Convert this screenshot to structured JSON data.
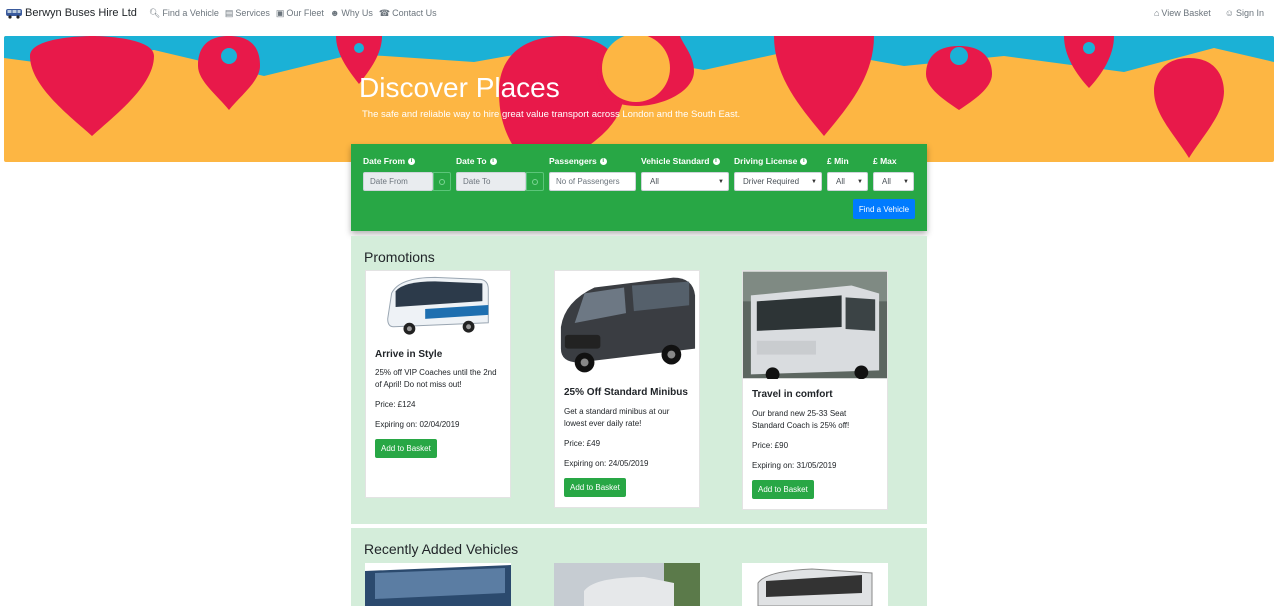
{
  "navbar": {
    "brand": "Berwyn Buses Hire Ltd",
    "items": [
      {
        "label": "Find a Vehicle",
        "icon": "search-icon"
      },
      {
        "label": "Services",
        "icon": "list-icon"
      },
      {
        "label": "Our Fleet",
        "icon": "bus-icon"
      },
      {
        "label": "Why Us",
        "icon": "users-icon"
      },
      {
        "label": "Contact Us",
        "icon": "phone-icon"
      }
    ],
    "right": [
      {
        "label": "View Basket",
        "icon": "basket-icon"
      },
      {
        "label": "Sign In",
        "icon": "user-icon"
      }
    ]
  },
  "hero": {
    "title": "Discover Places",
    "subtitle": "The safe and reliable way to hire great value transport across London and the South East."
  },
  "search": {
    "date_from": {
      "label": "Date From",
      "placeholder": "Date From"
    },
    "date_to": {
      "label": "Date To",
      "placeholder": "Date To"
    },
    "passengers": {
      "label": "Passengers",
      "placeholder": "No of Passengers"
    },
    "vehicle_standard": {
      "label": "Vehicle Standard",
      "value": "All"
    },
    "driving_license": {
      "label": "Driving License",
      "value": "Driver Required"
    },
    "min": {
      "label": "£ Min",
      "value": "All"
    },
    "max": {
      "label": "£ Max",
      "value": "All"
    },
    "button": "Find a Vehicle"
  },
  "promotions": {
    "title": "Promotions",
    "cards": [
      {
        "title": "Arrive in Style",
        "text": "25% off VIP Coaches until the 2nd of April! Do not miss out!",
        "price": "Price: £124",
        "expiry": "Expiring on: 02/04/2019",
        "button": "Add to Basket"
      },
      {
        "title": "25% Off Standard Minibus",
        "text": "Get a standard minibus at our lowest ever daily rate!",
        "price": "Price: £49",
        "expiry": "Expiring on: 24/05/2019",
        "button": "Add to Basket"
      },
      {
        "title": "Travel in comfort",
        "text": "Our brand new 25-33 Seat Standard Coach is 25% off!",
        "price": "Price: £90",
        "expiry": "Expiring on: 31/05/2019",
        "button": "Add to Basket"
      }
    ]
  },
  "recent": {
    "title": "Recently Added Vehicles"
  },
  "colors": {
    "primary": "#007bff",
    "success": "#28a745",
    "section_bg": "#d4edda",
    "hero_yellow": "#fdb643",
    "hero_red": "#e8194a",
    "hero_blue": "#1bb1d6"
  }
}
